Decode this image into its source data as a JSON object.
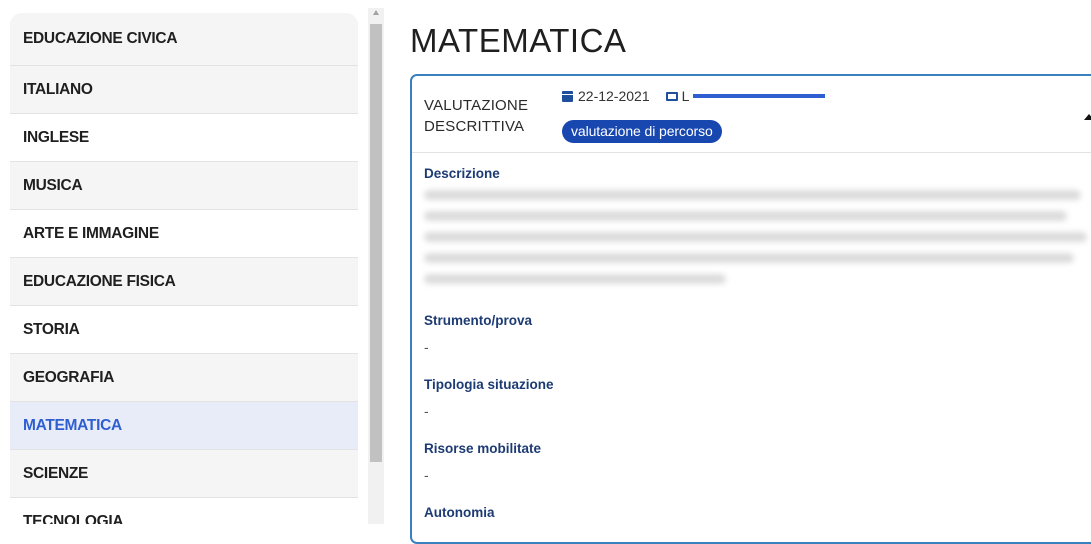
{
  "sidebar": {
    "subjects": [
      {
        "label": "EDUCAZIONE CIVICA"
      },
      {
        "label": "ITALIANO"
      },
      {
        "label": "INGLESE"
      },
      {
        "label": "MUSICA"
      },
      {
        "label": "ARTE E IMMAGINE"
      },
      {
        "label": "EDUCAZIONE FISICA"
      },
      {
        "label": "STORIA"
      },
      {
        "label": "GEOGRAFIA"
      },
      {
        "label": "MATEMATICA"
      },
      {
        "label": "SCIENZE"
      },
      {
        "label": "TECNOLOGIA"
      }
    ],
    "active": "MATEMATICA"
  },
  "main": {
    "title": "MATEMATICA",
    "card": {
      "type_label_line1": "VALUTAZIONE",
      "type_label_line2": "DESCRITTIVA",
      "date": "22-12-2021",
      "teacher_initial": "L",
      "badge": "valutazione di percorso",
      "sections": [
        {
          "title": "Descrizione",
          "value": ""
        },
        {
          "title": "Strumento/prova",
          "value": "-"
        },
        {
          "title": "Tipologia situazione",
          "value": "-"
        },
        {
          "title": "Risorse mobilitate",
          "value": "-"
        },
        {
          "title": "Autonomia",
          "value": ""
        }
      ]
    }
  },
  "colors": {
    "accent": "#2f5ed0",
    "badge": "#1947b0",
    "card_border": "#3a80bf",
    "section_title": "#1d3b73"
  },
  "icons": [
    "calendar-icon",
    "teacher-icon",
    "collapse-caret-icon",
    "scroll-up-arrow-icon"
  ]
}
